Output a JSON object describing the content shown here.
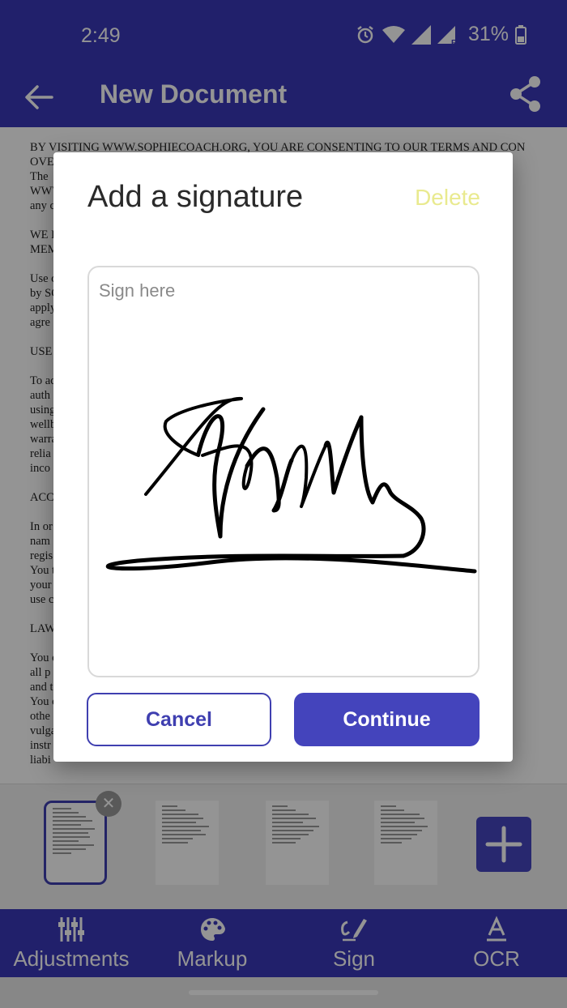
{
  "status_bar": {
    "time": "2:49",
    "battery": "31%"
  },
  "app_bar": {
    "title": "New Document",
    "back_icon": "arrow-left-icon",
    "share_icon": "share-icon"
  },
  "document": {
    "text": "BY VISITING WWW.SOPHIECOACH.ORG, YOU ARE CONSENTING TO OUR TERMS AND CON\nOVE\nThe                                                                                                                                                     \nWWW                                                                                                                                              and\nany c\n\nWE E\nMEM\n\nUse c                                                                                                                                              ded\nby SO                                                                                                                                             as\napply                                                                                                                                             ou\nagre\n\nUSE O\n\nTo ac\nauth                                                                                                                                             om\nusing\nwellb                                                                                                                                          n or\nwarra                                                                                                                                         lete,\nrelia                                                                                                                                              or\ninco\n\nACCO\n\nIn or                                                                                                                                             your\nnam\nregis                                                                                                                                            date.\nYou                                                                                                                                              than\nyour                                                                                                                                           n the\nuse c\n\nLAWF\n\nYou                                                                                                                                              e for\nall p                                                                                                                                           e Site\nand t                                                                                                                                            ly.\nYou                                                                                                                                                of\nothe                                                                                                                                            ats,\nvulga\ninstr\nliabi"
  },
  "dialog": {
    "title": "Add a signature",
    "delete_label": "Delete",
    "placeholder": "Sign here",
    "cancel_label": "Cancel",
    "continue_label": "Continue"
  },
  "thumbnails": {
    "count": 4,
    "selected_index": 0,
    "remove_icon": "close-icon",
    "add_icon": "plus-icon"
  },
  "bottom_nav": {
    "items": [
      {
        "label": "Adjustments",
        "icon": "sliders-icon"
      },
      {
        "label": "Markup",
        "icon": "palette-icon"
      },
      {
        "label": "Sign",
        "icon": "signature-pen-icon"
      },
      {
        "label": "OCR",
        "icon": "text-recognition-icon"
      }
    ]
  },
  "colors": {
    "primary": "#3a37b8",
    "button": "#4444bc",
    "delete_disabled": "#e9ea8f"
  }
}
